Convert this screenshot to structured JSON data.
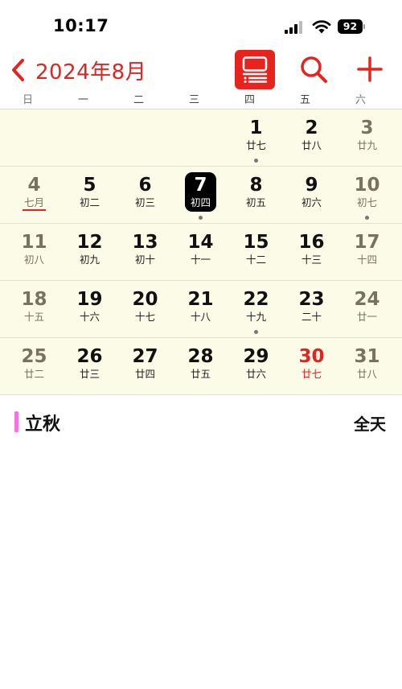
{
  "status_bar": {
    "time": "10:17",
    "battery": "92"
  },
  "header": {
    "month_title": "2024年8月"
  },
  "weekdays": [
    "日",
    "一",
    "二",
    "三",
    "四",
    "五",
    "六"
  ],
  "calendar": {
    "weeks": [
      [
        {
          "day": "",
          "lunar": ""
        },
        {
          "day": "",
          "lunar": ""
        },
        {
          "day": "",
          "lunar": ""
        },
        {
          "day": "",
          "lunar": ""
        },
        {
          "day": "1",
          "lunar": "廿七",
          "dot": true
        },
        {
          "day": "2",
          "lunar": "廿八"
        },
        {
          "day": "3",
          "lunar": "廿九"
        }
      ],
      [
        {
          "day": "4",
          "lunar": "七月",
          "underline": true
        },
        {
          "day": "5",
          "lunar": "初二"
        },
        {
          "day": "6",
          "lunar": "初三"
        },
        {
          "day": "7",
          "lunar": "初四",
          "selected": true,
          "dot": true
        },
        {
          "day": "8",
          "lunar": "初五"
        },
        {
          "day": "9",
          "lunar": "初六"
        },
        {
          "day": "10",
          "lunar": "初七",
          "dot": true
        }
      ],
      [
        {
          "day": "11",
          "lunar": "初八"
        },
        {
          "day": "12",
          "lunar": "初九"
        },
        {
          "day": "13",
          "lunar": "初十"
        },
        {
          "day": "14",
          "lunar": "十一"
        },
        {
          "day": "15",
          "lunar": "十二"
        },
        {
          "day": "16",
          "lunar": "十三"
        },
        {
          "day": "17",
          "lunar": "十四"
        }
      ],
      [
        {
          "day": "18",
          "lunar": "十五"
        },
        {
          "day": "19",
          "lunar": "十六"
        },
        {
          "day": "20",
          "lunar": "十七"
        },
        {
          "day": "21",
          "lunar": "十八"
        },
        {
          "day": "22",
          "lunar": "十九",
          "dot": true
        },
        {
          "day": "23",
          "lunar": "二十"
        },
        {
          "day": "24",
          "lunar": "廿一"
        }
      ],
      [
        {
          "day": "25",
          "lunar": "廿二"
        },
        {
          "day": "26",
          "lunar": "廿三"
        },
        {
          "day": "27",
          "lunar": "廿四"
        },
        {
          "day": "28",
          "lunar": "廿五"
        },
        {
          "day": "29",
          "lunar": "廿六"
        },
        {
          "day": "30",
          "lunar": "廿七",
          "today": true
        },
        {
          "day": "31",
          "lunar": "廿八"
        }
      ]
    ]
  },
  "event": {
    "title": "立秋",
    "time": "全天",
    "color": "#f472e6"
  },
  "colors": {
    "accent": "#e8221c",
    "grid_background": "#fcfbe8",
    "selected": "#000000"
  },
  "icons": [
    "signal-icon",
    "wifi-icon",
    "battery-icon",
    "chevron-left-icon",
    "list-view-icon",
    "search-icon",
    "plus-icon"
  ]
}
